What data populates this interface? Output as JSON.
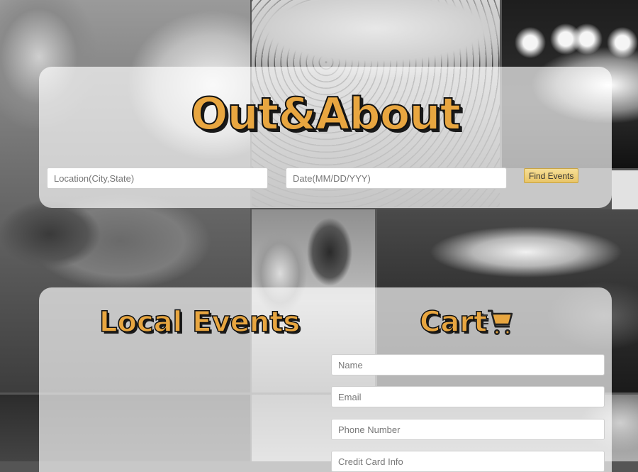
{
  "app": {
    "logo_text": "Out&About"
  },
  "search": {
    "location_placeholder": "Location(City,State)",
    "date_placeholder": "Date(MM/DD/YYY)",
    "find_button_label": "Find Events"
  },
  "sections": {
    "local_events_title": "Local Events",
    "cart_title": "Cart"
  },
  "cart_form": {
    "name_placeholder": "Name",
    "email_placeholder": "Email",
    "phone_placeholder": "Phone Number",
    "card_placeholder": "Credit Card Info"
  },
  "icons": {
    "cart": "shopping-cart-icon"
  },
  "colors": {
    "accent": "#e8a640",
    "button": "#efd27f"
  }
}
